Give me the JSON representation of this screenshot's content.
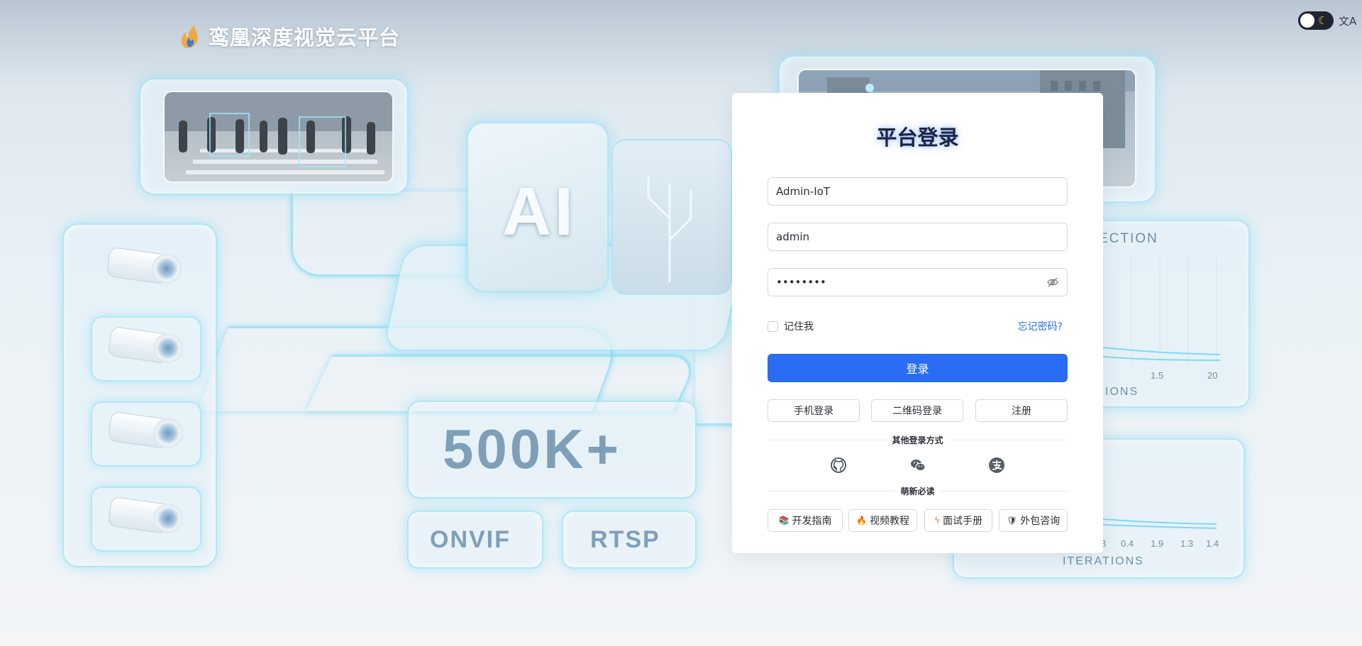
{
  "brand": {
    "title": "鸾凰深度视觉云平台",
    "logo_icon": "flame-logo-icon"
  },
  "topbar": {
    "theme_toggle_icon": "moon-icon",
    "translate_icon": "translate-icon",
    "translate_glyph": "文A"
  },
  "background": {
    "ai_block": "AI",
    "stat": "500K+",
    "protocols": [
      "ONVIF",
      "RTSP"
    ],
    "chart_title_fragment": "ECTION",
    "chart_bottom_fragment": "IONS",
    "chart_ticks_top": [
      "1.5",
      "20"
    ],
    "chart_ticks_bottom": [
      "3",
      "0.4",
      "1.9",
      "1.3",
      "1.4"
    ],
    "chart_bottom_label": "ITERATIONS"
  },
  "login": {
    "title": "平台登录",
    "tenant_value": "Admin-IoT",
    "username_value": "admin",
    "password_value": "••••••••",
    "password_icon": "eye-off-icon",
    "remember_label": "记住我",
    "forgot_label": "忘记密码?",
    "submit_label": "登录",
    "alt_buttons": {
      "phone": "手机登录",
      "qrcode": "二维码登录",
      "register": "注册"
    },
    "other_methods_label": "其他登录方式",
    "social": [
      "github-icon",
      "wechat-icon",
      "alipay-icon"
    ],
    "newbie_label": "萌新必读",
    "read_buttons": {
      "dev_guide": "开发指南",
      "video": "视频教程",
      "interview": "面试手册",
      "outsource": "外包咨询"
    }
  },
  "colors": {
    "primary": "#2b6cf5",
    "link": "#2f6cf6",
    "toggle_bg": "#1f2430"
  }
}
